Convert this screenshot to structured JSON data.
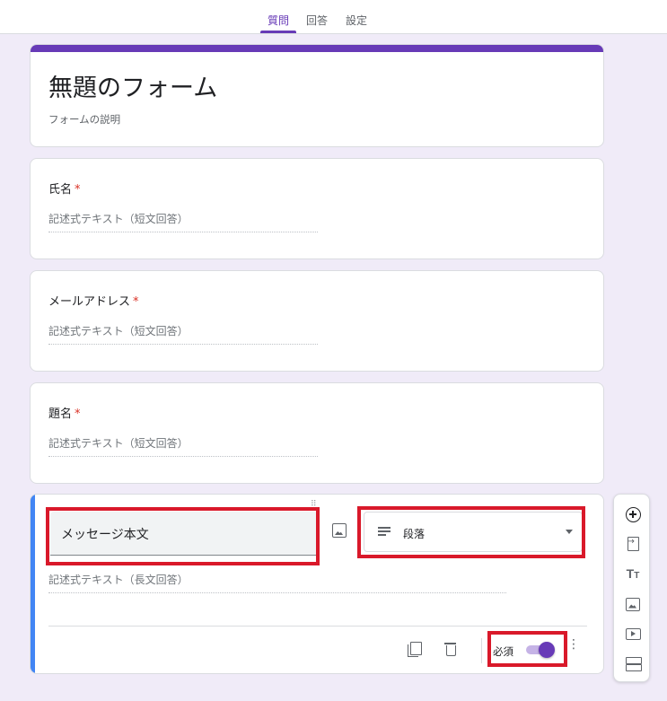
{
  "tabs": [
    {
      "label": "質問",
      "active": true
    },
    {
      "label": "回答",
      "active": false
    },
    {
      "label": "設定",
      "active": false
    }
  ],
  "form": {
    "title": "無題のフォーム",
    "description": "フォームの説明"
  },
  "questions": [
    {
      "title": "氏名",
      "required_mark": "*",
      "answer_placeholder": "記述式テキスト（短文回答）"
    },
    {
      "title": "メールアドレス",
      "required_mark": "*",
      "answer_placeholder": "記述式テキスト（短文回答）"
    },
    {
      "title": "題名",
      "required_mark": "*",
      "answer_placeholder": "記述式テキスト（短文回答）"
    }
  ],
  "active_question": {
    "drag_handle": "⠿",
    "title": "メッセージ本文",
    "type_label": "段落",
    "answer_placeholder": "記述式テキスト（長文回答）",
    "required_label": "必須",
    "required_on": true,
    "more_icon": "⋮"
  },
  "toolbar": {
    "items": [
      "add-question-icon",
      "import-questions-icon",
      "add-title-icon",
      "add-image-icon",
      "add-video-icon",
      "add-section-icon"
    ],
    "title_icon_text": "T",
    "title_icon_small": "T"
  },
  "colors": {
    "accent": "#673ab7",
    "active_bar": "#4285f4",
    "highlight": "#d9192a",
    "background": "#f0ebf8",
    "required": "#d93025"
  }
}
